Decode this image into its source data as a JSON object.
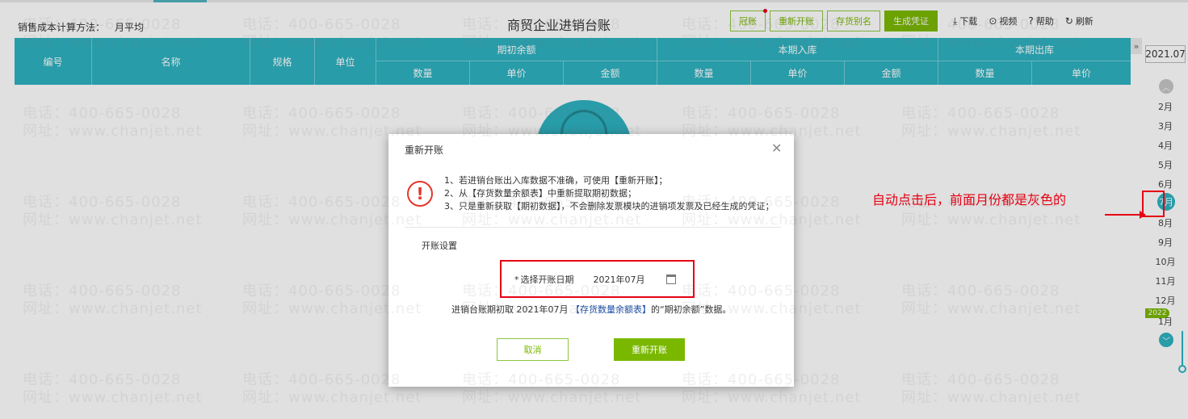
{
  "page": {
    "cost_method_label": "销售成本计算方法：",
    "cost_method_value": "月平均",
    "title": "商贸企业进销台账"
  },
  "toolbar": {
    "btn_carryover": "冠账",
    "btn_reopen": "重新开账",
    "btn_stock_alias": "存货别名",
    "btn_voucher": "生成凭证",
    "download": "下载",
    "video": "视频",
    "help": "帮助",
    "refresh": "刷新"
  },
  "icons": {
    "download": "download-icon",
    "video": "play-icon",
    "help": "help-icon",
    "refresh": "refresh-icon",
    "warn": "warning-icon",
    "close": "close-icon",
    "calendar": "calendar-icon"
  },
  "table": {
    "col_code": "编号",
    "col_name": "名称",
    "col_spec": "规格",
    "col_unit": "单位",
    "group_opening": "期初余额",
    "group_in": "本期入库",
    "group_out": "本期出库",
    "sub_qty": "数量",
    "sub_price": "单价",
    "sub_amount": "金额"
  },
  "rail": {
    "toggle": "»",
    "year": "2021.07",
    "months": [
      "2月",
      "3月",
      "4月",
      "5月",
      "6月",
      "7月",
      "8月",
      "9月",
      "10月",
      "11月",
      "12月",
      "1月"
    ],
    "active_month": "7月",
    "year_tag": "2022"
  },
  "dialog": {
    "title": "重新开账",
    "notes": [
      "1、若进销台账出入库数据不准确，可使用【重新开账】；",
      "2、从【存货数量余额表】中重新提取期初数据；",
      "3、只是重新获取【期初数据】，不会删除发票模块的进销项发票及已经生成的凭证；"
    ],
    "section": "开账设置",
    "date_label": "选择开账日期",
    "date_required": "*",
    "date_value": "2021年07月",
    "info_prefix": "进销台账期初取 2021年07月 ",
    "info_link": "【存货数量余额表】",
    "info_suffix": "的“期初余额”数据。",
    "cancel": "取消",
    "confirm": "重新开账"
  },
  "watermark": {
    "phone": "电话：400-665-0028",
    "site": "网址：www.chanjet.net"
  },
  "annotation": {
    "text": "自动点击后，前面月份都是灰色的"
  },
  "colors": {
    "teal": "#2eb2c1",
    "green": "#7ab800",
    "red": "#e60012"
  }
}
